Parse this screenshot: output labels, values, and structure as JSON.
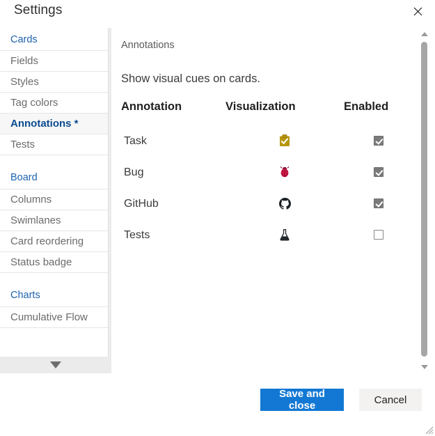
{
  "window": {
    "title": "Settings",
    "close_icon": "close-icon",
    "resize_grip_icon": "resize-grip-icon"
  },
  "sidebar": {
    "scroll_down_icon": "chevron-down-icon",
    "groups": [
      {
        "label": "Cards",
        "items": [
          {
            "label": "Fields",
            "selected": false
          },
          {
            "label": "Styles",
            "selected": false
          },
          {
            "label": "Tag colors",
            "selected": false
          },
          {
            "label": "Annotations *",
            "selected": true
          },
          {
            "label": "Tests",
            "selected": false
          }
        ]
      },
      {
        "label": "Board",
        "items": [
          {
            "label": "Columns",
            "selected": false
          },
          {
            "label": "Swimlanes",
            "selected": false
          },
          {
            "label": "Card reordering",
            "selected": false
          },
          {
            "label": "Status badge",
            "selected": false
          }
        ]
      },
      {
        "label": "Charts",
        "items": [
          {
            "label": "Cumulative Flow",
            "selected": false
          }
        ]
      }
    ]
  },
  "content": {
    "breadcrumb": "Annotations",
    "description": "Show visual cues on cards.",
    "table": {
      "headers": {
        "annotation": "Annotation",
        "visualization": "Visualization",
        "enabled": "Enabled"
      },
      "rows": [
        {
          "name": "Task",
          "icon": "clipboard-check-icon",
          "enabled": true
        },
        {
          "name": "Bug",
          "icon": "ladybug-icon",
          "enabled": true
        },
        {
          "name": "GitHub",
          "icon": "github-icon",
          "enabled": true
        },
        {
          "name": "Tests",
          "icon": "flask-icon",
          "enabled": false
        }
      ]
    }
  },
  "scrollbar": {
    "up_icon": "scroll-up-arrow-icon",
    "down_icon": "scroll-down-arrow-icon"
  },
  "footer": {
    "save_label": "Save and close",
    "cancel_label": "Cancel"
  },
  "colors": {
    "accent_blue": "#1278d4",
    "group_header_blue": "#1d63ad",
    "selected_text_blue": "#0b4a8f",
    "selection_bar": "#1f69b3",
    "task_icon_yellow": "#b8960c",
    "bug_icon_red": "#d6184a",
    "github_icon_black": "#1b1f23",
    "flask_icon_black": "#24292e"
  }
}
